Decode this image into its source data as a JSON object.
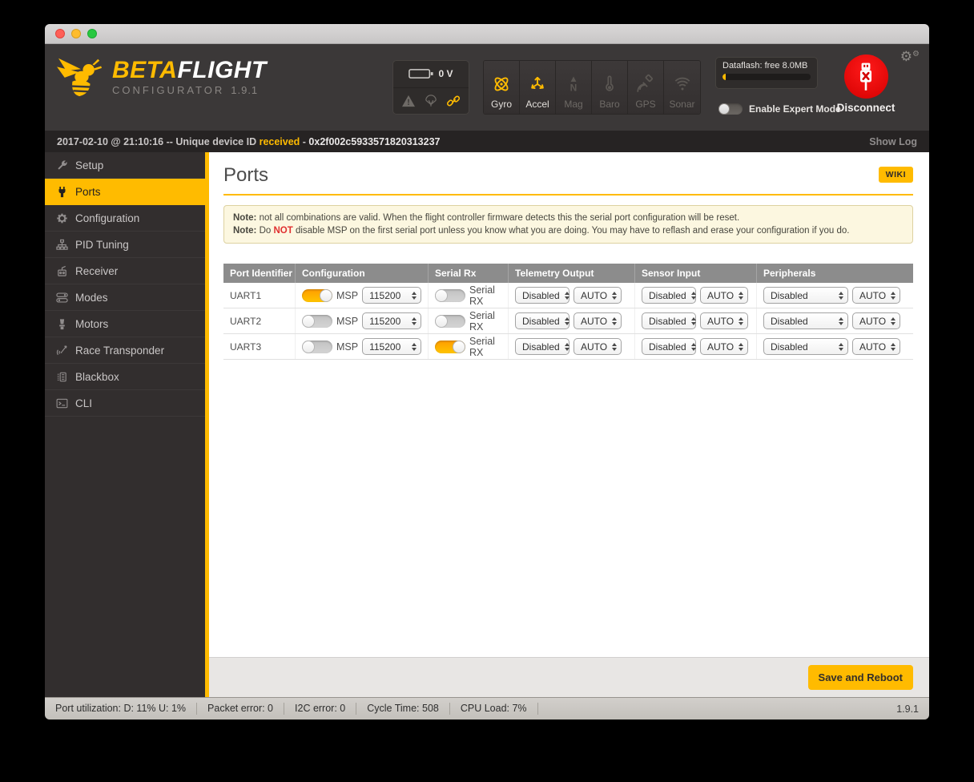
{
  "colors": {
    "accent": "#ffbb00",
    "disconnect_red": "#e10000",
    "note_emphasis_red": "#e03030"
  },
  "header": {
    "logo": {
      "brand_bold": "BETA",
      "brand_light": "FLIGHT",
      "subtitle": "CONFIGURATOR",
      "version": "1.9.1"
    },
    "battery": {
      "voltage": "0 V"
    },
    "sensors": [
      {
        "label": "Gyro",
        "icon": "gyro",
        "active": true
      },
      {
        "label": "Accel",
        "icon": "accel",
        "active": true
      },
      {
        "label": "Mag",
        "icon": "mag",
        "active": false
      },
      {
        "label": "Baro",
        "icon": "baro",
        "active": false
      },
      {
        "label": "GPS",
        "icon": "gps",
        "active": false
      },
      {
        "label": "Sonar",
        "icon": "sonar",
        "active": false
      }
    ],
    "dataflash": {
      "label": "Dataflash: free 8.0MB",
      "progress_percent": 4
    },
    "expert_mode": {
      "label": "Enable Expert Mode",
      "enabled": false
    },
    "disconnect_label": "Disconnect"
  },
  "log_bar": {
    "prefix": "2017-02-10 @ 21:10:16 -- Unique device ID ",
    "highlight": "received",
    "separator": " - ",
    "device_id": "0x2f002c5933571820313237",
    "show_log": "Show Log"
  },
  "sidebar": {
    "items": [
      {
        "label": "Setup",
        "icon": "wrench",
        "active": false
      },
      {
        "label": "Ports",
        "icon": "plug",
        "active": true
      },
      {
        "label": "Configuration",
        "icon": "gear",
        "active": false
      },
      {
        "label": "PID Tuning",
        "icon": "sitemap",
        "active": false
      },
      {
        "label": "Receiver",
        "icon": "receiver",
        "active": false
      },
      {
        "label": "Modes",
        "icon": "modes",
        "active": false
      },
      {
        "label": "Motors",
        "icon": "motor",
        "active": false
      },
      {
        "label": "Race Transponder",
        "icon": "transponder",
        "active": false
      },
      {
        "label": "Blackbox",
        "icon": "blackbox",
        "active": false
      },
      {
        "label": "CLI",
        "icon": "cli",
        "active": false
      }
    ]
  },
  "main": {
    "title": "Ports",
    "wiki_label": "WIKI",
    "notes": [
      {
        "bold": "Note:",
        "before": " not all combinations are valid. When the flight controller firmware detects this the serial port configuration will be reset.",
        "em": "",
        "after": ""
      },
      {
        "bold": "Note:",
        "before": " Do ",
        "em": "NOT",
        "after": " disable MSP on the first serial port unless you know what you are doing. You may have to reflash and erase your configuration if you do."
      }
    ],
    "table": {
      "headers": [
        "Port Identifier",
        "Configuration",
        "Serial Rx",
        "Telemetry Output",
        "Sensor Input",
        "Peripherals"
      ],
      "rows": [
        {
          "port": "UART1",
          "msp_on": true,
          "msp_label": "MSP",
          "baud": "115200",
          "srx_on": false,
          "srx_label": "Serial RX",
          "tel": "Disabled",
          "tel_baud": "AUTO",
          "sen": "Disabled",
          "sen_baud": "AUTO",
          "per": "Disabled",
          "per_baud": "AUTO"
        },
        {
          "port": "UART2",
          "msp_on": false,
          "msp_label": "MSP",
          "baud": "115200",
          "srx_on": false,
          "srx_label": "Serial RX",
          "tel": "Disabled",
          "tel_baud": "AUTO",
          "sen": "Disabled",
          "sen_baud": "AUTO",
          "per": "Disabled",
          "per_baud": "AUTO"
        },
        {
          "port": "UART3",
          "msp_on": false,
          "msp_label": "MSP",
          "baud": "115200",
          "srx_on": true,
          "srx_label": "Serial RX",
          "tel": "Disabled",
          "tel_baud": "AUTO",
          "sen": "Disabled",
          "sen_baud": "AUTO",
          "per": "Disabled",
          "per_baud": "AUTO"
        }
      ]
    },
    "save_label": "Save and Reboot"
  },
  "status_bar": {
    "items": [
      "Port utilization: D: 11% U: 1%",
      "Packet error: 0",
      "I2C error: 0",
      "Cycle Time: 508",
      "CPU Load: 7%"
    ],
    "version": "1.9.1"
  }
}
